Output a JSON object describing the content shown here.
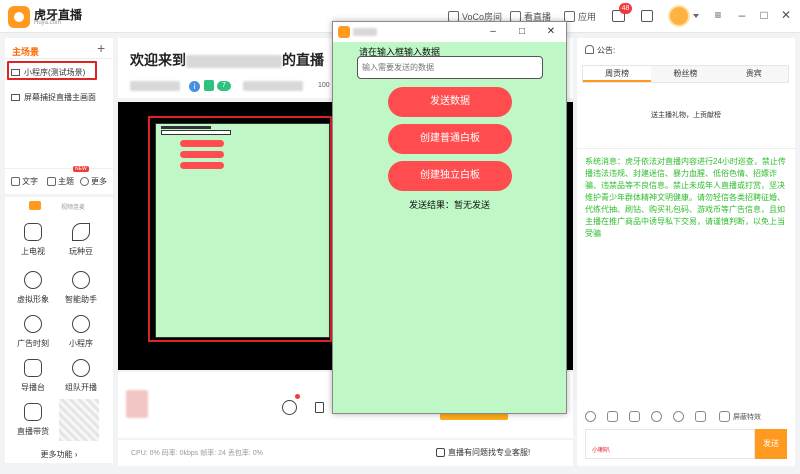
{
  "window": {
    "brand_name": "虎牙直播",
    "brand_sub": "Huya.com"
  },
  "titlebar": {
    "voco_label": "VoCo房间",
    "viewing_label": "看直播",
    "apps_label": "应用",
    "notif_count": "48"
  },
  "scenes": {
    "title": "主场景",
    "add": "+",
    "items": [
      {
        "label": "小程序(测试场景)"
      },
      {
        "label": "屏幕捕捉直播主画面"
      }
    ]
  },
  "quick_tools": [
    {
      "label": "文字"
    },
    {
      "label": "主题"
    },
    {
      "label": "更多"
    }
  ],
  "tools": {
    "top_label": "视频连麦",
    "items": [
      {
        "label": "上电视",
        "icon": "tv-icon"
      },
      {
        "label": "玩种豆",
        "icon": "leaf-icon"
      },
      {
        "label": "虚拟形象",
        "icon": "avatar-icon"
      },
      {
        "label": "智能助手",
        "icon": "assistant-icon"
      },
      {
        "label": "广告时刻",
        "icon": "ad-icon"
      },
      {
        "label": "小程序",
        "icon": "miniapp-icon"
      },
      {
        "label": "导播台",
        "icon": "director-icon"
      },
      {
        "label": "组队开播",
        "icon": "team-icon"
      },
      {
        "label": "直播带货",
        "icon": "shop-icon"
      }
    ],
    "more": "更多功能 ›"
  },
  "room": {
    "title_prefix": "欢迎来到",
    "title_suffix": "的直播",
    "level": "7",
    "fans": "100"
  },
  "status": {
    "perf": "CPU: 0%  码率: 0kbps  帧率: 24  丢包率: 0%",
    "help": "直播有问题找专业客服!"
  },
  "chat": {
    "announce": "公告:",
    "tabs": [
      "周贡榜",
      "粉丝榜",
      "贵宾"
    ],
    "gift_text": "送主播礼物，上贡献榜",
    "system_message": "系统消息：虎牙依法对直播内容进行24小时巡查，禁止传播违法违规、封建迷信、暴力血腥、低俗色情、招嫖诈骗、违禁品等不良信息。禁止未成年人直播或打赏，坚决维护青少年群体精神文明健康。请勿轻信各类招聘征婚、代练代抽、刷钻、购买礼包码、游戏币等广告信息，且如主播在推广商品中诱导私下交易，请谨慎判断，以免上当受骗",
    "mask_effect": "屏蔽特效",
    "ticket_label": "小喇叭",
    "send": "发送"
  },
  "miniapp": {
    "prompt": "请在输入框输入数据",
    "input_placeholder": "输入需要发送的数据",
    "send_data": "发送数据",
    "create_normal_board": "创建普通白板",
    "create_independent_board": "创建独立白板",
    "result": "发送结果：暂无发送"
  },
  "colors": {
    "accent": "#ff9a1f",
    "miniapp_bg": "#bff8c6",
    "button_red": "#ff4d4f",
    "system_text": "#2ebd2e",
    "highlight_red": "#e02424"
  }
}
